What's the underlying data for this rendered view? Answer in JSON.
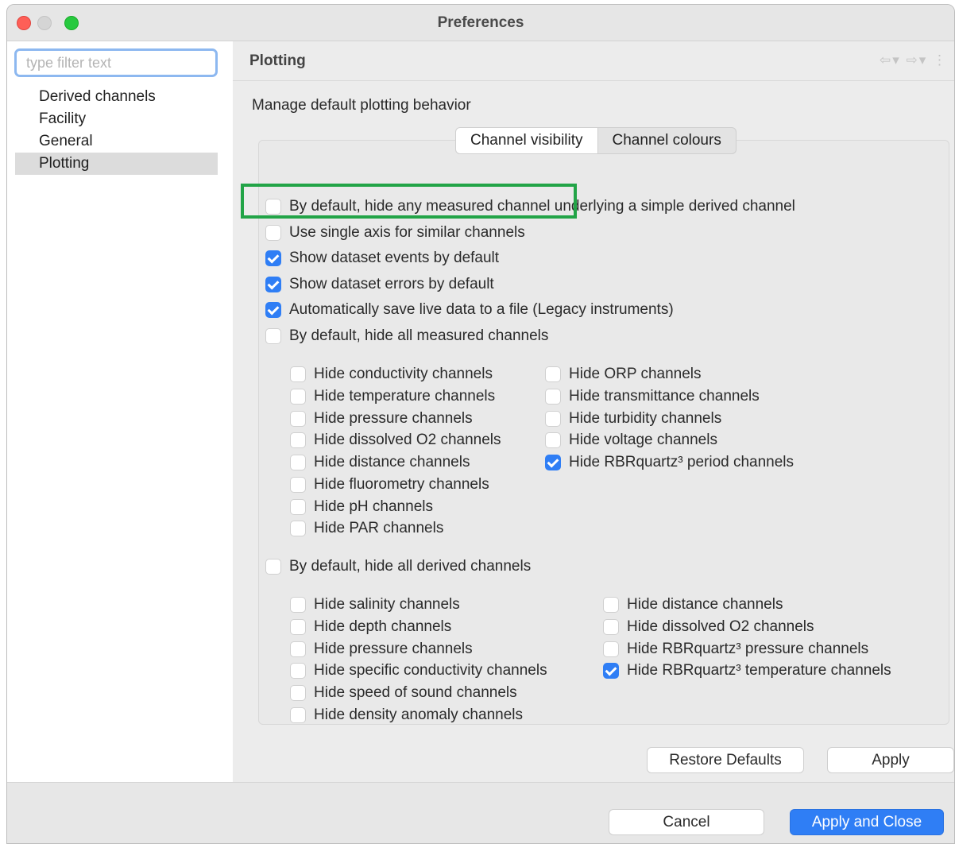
{
  "window": {
    "title": "Preferences"
  },
  "sidebar": {
    "filter_placeholder": "type filter text",
    "items": [
      {
        "label": "Derived channels",
        "selected": false
      },
      {
        "label": "Facility",
        "selected": false
      },
      {
        "label": "General",
        "selected": false
      },
      {
        "label": "Plotting",
        "selected": true
      }
    ]
  },
  "page": {
    "title": "Plotting",
    "nav_icons": [
      "back-arrow-icon",
      "forward-arrow-icon",
      "more-menu-icon"
    ],
    "description": "Manage default plotting behavior",
    "tabs": [
      {
        "label": "Channel visibility",
        "active": true
      },
      {
        "label": "Channel colours",
        "active": false
      }
    ],
    "general_options": [
      {
        "label": "By default, hide any measured channel underlying a simple derived channel",
        "checked": false
      },
      {
        "label": "Use single axis for similar channels",
        "checked": false,
        "highlighted": true
      },
      {
        "label": "Show dataset events by default",
        "checked": true
      },
      {
        "label": "Show dataset errors by default",
        "checked": true
      },
      {
        "label": "Automatically save live data to a file (Legacy instruments)",
        "checked": true
      },
      {
        "label": "By default, hide all measured channels",
        "checked": false
      }
    ],
    "measured_left": [
      {
        "label": "Hide conductivity channels",
        "checked": false
      },
      {
        "label": "Hide temperature channels",
        "checked": false
      },
      {
        "label": "Hide pressure channels",
        "checked": false
      },
      {
        "label": "Hide dissolved O2 channels",
        "checked": false
      },
      {
        "label": "Hide distance channels",
        "checked": false
      },
      {
        "label": "Hide fluorometry channels",
        "checked": false
      },
      {
        "label": "Hide pH channels",
        "checked": false
      },
      {
        "label": "Hide PAR channels",
        "checked": false
      }
    ],
    "measured_right": [
      {
        "label": "Hide ORP channels",
        "checked": false
      },
      {
        "label": "Hide transmittance channels",
        "checked": false
      },
      {
        "label": "Hide turbidity channels",
        "checked": false
      },
      {
        "label": "Hide voltage channels",
        "checked": false
      },
      {
        "label": "Hide RBRquartz³ period channels",
        "checked": true
      }
    ],
    "derived_toggle": {
      "label": "By default, hide all derived channels",
      "checked": false
    },
    "derived_left": [
      {
        "label": "Hide salinity channels",
        "checked": false
      },
      {
        "label": "Hide depth channels",
        "checked": false
      },
      {
        "label": "Hide pressure channels",
        "checked": false
      },
      {
        "label": "Hide specific conductivity channels",
        "checked": false
      },
      {
        "label": "Hide speed of sound channels",
        "checked": false
      },
      {
        "label": "Hide density anomaly channels",
        "checked": false
      }
    ],
    "derived_right": [
      {
        "label": "Hide distance channels",
        "checked": false
      },
      {
        "label": "Hide dissolved O2 channels",
        "checked": false
      },
      {
        "label": "Hide RBRquartz³ pressure channels",
        "checked": false
      },
      {
        "label": "Hide RBRquartz³ temperature channels",
        "checked": true
      }
    ],
    "restore_defaults_label": "Restore Defaults",
    "apply_label": "Apply"
  },
  "footer": {
    "cancel_label": "Cancel",
    "apply_close_label": "Apply and Close"
  },
  "colors": {
    "accent": "#2f7ef5",
    "highlight": "#22a447",
    "close": "#fe5f57",
    "maximize": "#27c93f"
  }
}
